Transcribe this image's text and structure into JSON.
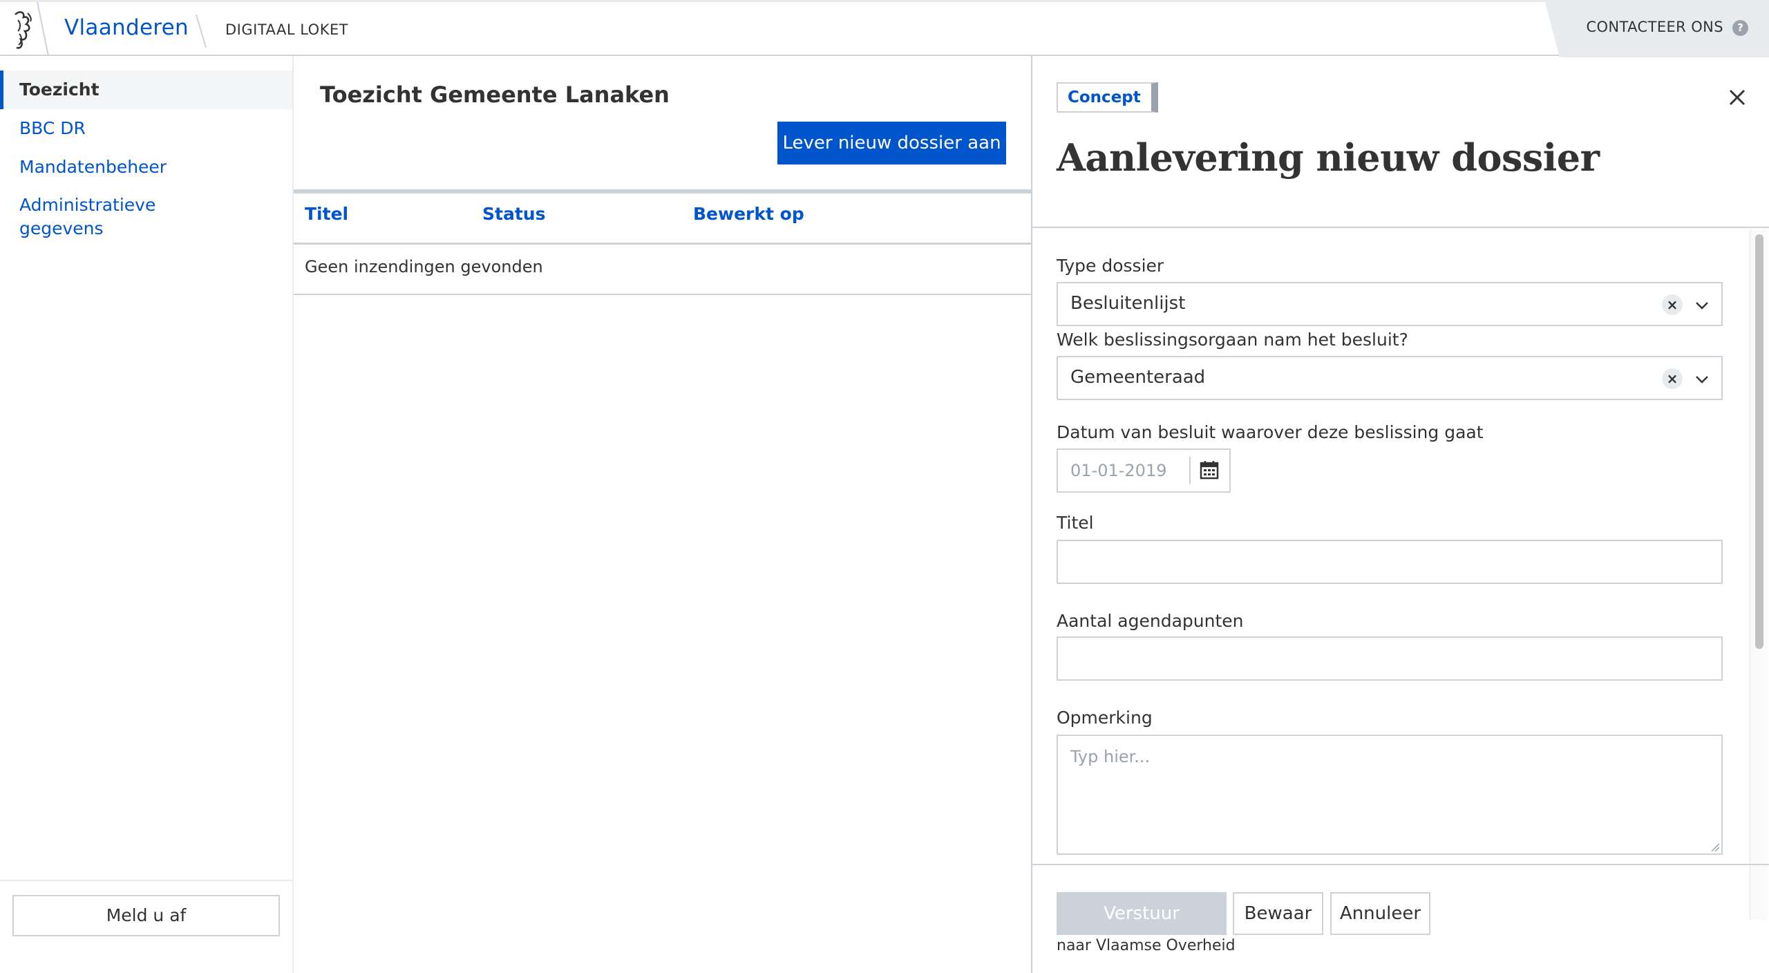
{
  "header": {
    "brand": "Vlaanderen",
    "subbrand": "DIGITAAL LOKET",
    "contact_label": "CONTACTEER ONS",
    "help_glyph": "?",
    "icons": [
      "lion-logo-icon",
      "help-icon"
    ]
  },
  "sidebar": {
    "items": [
      {
        "label": "Toezicht",
        "active": true
      },
      {
        "label": "BBC DR",
        "active": false
      },
      {
        "label": "Mandatenbeheer",
        "active": false
      },
      {
        "label": "Administratieve",
        "label2": "gegevens",
        "active": false
      }
    ],
    "logout_label": "Meld u af"
  },
  "main": {
    "title": "Toezicht Gemeente Lanaken",
    "new_button": "Lever nieuw dossier aan",
    "table": {
      "columns": [
        "Titel",
        "Status",
        "Bewerkt op"
      ],
      "empty_message": "Geen inzendingen gevonden"
    }
  },
  "panel": {
    "status_pill": "Concept",
    "title": "Aanlevering nieuw dossier",
    "fields": {
      "type_label": "Type dossier",
      "type_value": "Besluitenlijst",
      "organ_label": "Welk beslissingsorgaan nam het besluit?",
      "organ_value": "Gemeenteraad",
      "date_label": "Datum van besluit waarover deze beslissing gaat",
      "date_placeholder": "01-01-2019",
      "title_label": "Titel",
      "title_value": "",
      "agenda_label": "Aantal agendapunten",
      "agenda_value": "",
      "remark_label": "Opmerking",
      "remark_placeholder": "Typ hier..."
    },
    "clear_glyph": "×",
    "buttons": {
      "send": "Verstuur",
      "save": "Bewaar",
      "cancel": "Annuleer"
    },
    "send_hint": "naar Vlaamse Overheid"
  },
  "colors": {
    "accent": "#0055cc",
    "text": "#333332",
    "border": "#cbd2da",
    "muted": "#9aa3ad",
    "panel_bg": "#e8ebee"
  }
}
